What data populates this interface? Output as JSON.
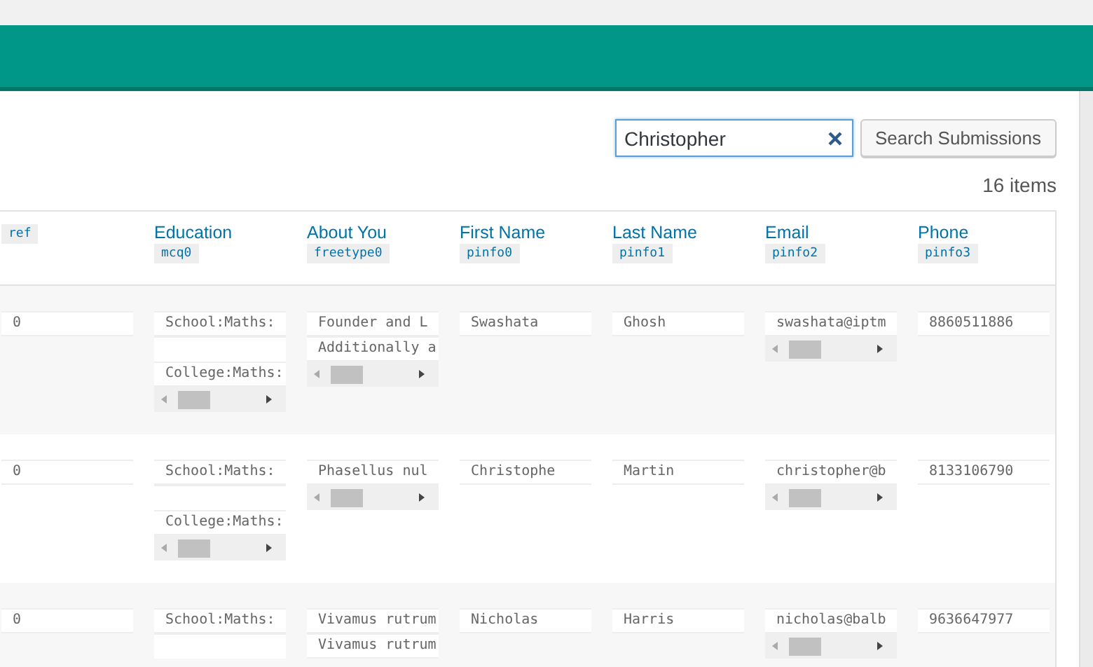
{
  "search": {
    "value": "Christopher",
    "button": "Search Submissions"
  },
  "item_count": "16 items",
  "table": {
    "columns": [
      {
        "tag": "ref"
      },
      {
        "label": "Education",
        "tag": "mcq0"
      },
      {
        "label": "About You",
        "tag": "freetype0"
      },
      {
        "label": "First Name",
        "tag": "pinfo0"
      },
      {
        "label": "Last Name",
        "tag": "pinfo1"
      },
      {
        "label": "Email",
        "tag": "pinfo2"
      },
      {
        "label": "Phone",
        "tag": "pinfo3"
      }
    ],
    "rows": [
      {
        "cells": [
          {
            "lines": [
              {
                "kind": "text",
                "text": "0"
              }
            ],
            "scrollbar": false
          },
          {
            "lines": [
              {
                "kind": "text",
                "text": "School:Maths:"
              },
              {
                "kind": "blank"
              },
              {
                "kind": "text",
                "text": "College:Maths:"
              }
            ],
            "scrollbar": true
          },
          {
            "lines": [
              {
                "kind": "text",
                "text": "Founder and L"
              },
              {
                "kind": "text",
                "text": "Additionally a"
              }
            ],
            "scrollbar": true
          },
          {
            "lines": [
              {
                "kind": "text",
                "text": "Swashata"
              }
            ],
            "scrollbar": false
          },
          {
            "lines": [
              {
                "kind": "text",
                "text": "Ghosh"
              }
            ],
            "scrollbar": false
          },
          {
            "lines": [
              {
                "kind": "text",
                "text": "swashata@iptm"
              }
            ],
            "scrollbar": true
          },
          {
            "lines": [
              {
                "kind": "text",
                "text": "8860511886"
              }
            ],
            "scrollbar": false
          }
        ]
      },
      {
        "cells": [
          {
            "lines": [
              {
                "kind": "text",
                "text": "0"
              }
            ],
            "scrollbar": false
          },
          {
            "lines": [
              {
                "kind": "text",
                "text": "School:Maths:"
              },
              {
                "kind": "blank"
              },
              {
                "kind": "text",
                "text": "College:Maths:"
              }
            ],
            "scrollbar": true
          },
          {
            "lines": [
              {
                "kind": "text",
                "text": "Phasellus nul"
              }
            ],
            "scrollbar": true
          },
          {
            "lines": [
              {
                "kind": "text",
                "text": "Christophe"
              }
            ],
            "scrollbar": false
          },
          {
            "lines": [
              {
                "kind": "text",
                "text": "Martin"
              }
            ],
            "scrollbar": false
          },
          {
            "lines": [
              {
                "kind": "text",
                "text": "christopher@b"
              }
            ],
            "scrollbar": true
          },
          {
            "lines": [
              {
                "kind": "text",
                "text": "8133106790"
              }
            ],
            "scrollbar": false
          }
        ]
      },
      {
        "cells": [
          {
            "lines": [
              {
                "kind": "text",
                "text": "0"
              }
            ],
            "scrollbar": false
          },
          {
            "lines": [
              {
                "kind": "text",
                "text": "School:Maths:"
              },
              {
                "kind": "blank"
              }
            ],
            "scrollbar": false
          },
          {
            "lines": [
              {
                "kind": "text",
                "text": "Vivamus rutrum"
              },
              {
                "kind": "text",
                "text": "Vivamus rutrum"
              }
            ],
            "scrollbar": false
          },
          {
            "lines": [
              {
                "kind": "text",
                "text": "Nicholas"
              }
            ],
            "scrollbar": false
          },
          {
            "lines": [
              {
                "kind": "text",
                "text": "Harris"
              }
            ],
            "scrollbar": false
          },
          {
            "lines": [
              {
                "kind": "text",
                "text": "nicholas@balb"
              }
            ],
            "scrollbar": true
          },
          {
            "lines": [
              {
                "kind": "text",
                "text": "9636647977"
              }
            ],
            "scrollbar": false
          }
        ]
      }
    ]
  }
}
